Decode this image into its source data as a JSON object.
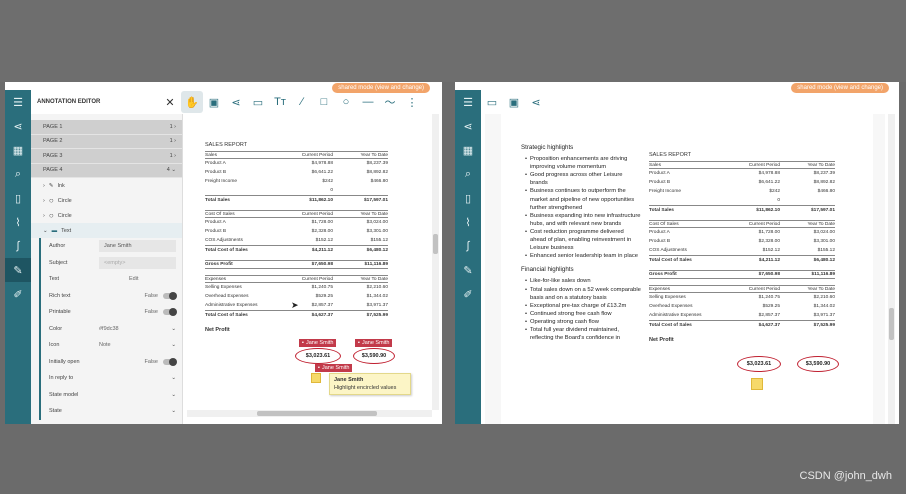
{
  "badge": "shared mode (view and change)",
  "left": {
    "panel_title": "ANNOTATION EDITOR",
    "rail_icons": [
      "menu-icon",
      "share-icon",
      "thumbnails-icon",
      "search-icon",
      "bookmark-icon",
      "attachment-icon",
      "signature-icon",
      "annotation-edit-icon",
      "form-edit-icon"
    ],
    "toolbar_icons": [
      "close-icon",
      "hand-icon",
      "save-icon",
      "share-icon",
      "comment-icon",
      "text-icon",
      "square-icon",
      "rectangle-icon",
      "circle-icon",
      "line-icon",
      "polyline-icon",
      "more-icon"
    ],
    "pages": [
      {
        "label": "PAGE 1",
        "count": "1"
      },
      {
        "label": "PAGE 2",
        "count": "1"
      },
      {
        "label": "PAGE 3",
        "count": "1"
      },
      {
        "label": "PAGE 4",
        "count": "4"
      }
    ],
    "tree": [
      "Ink",
      "Circle",
      "Circle",
      "Text"
    ],
    "props": {
      "author_k": "Author",
      "author_v": "Jane Smith",
      "subject_k": "Subject",
      "subject_v": "<empty>",
      "text_k": "Text",
      "text_v": "Edit",
      "rich_k": "Rich text",
      "rich_v": "False",
      "printable_k": "Printable",
      "printable_v": "False",
      "color_k": "Color",
      "color_v": "#f9dc38",
      "icon_k": "Icon",
      "icon_v": "Note",
      "open_k": "Initially open",
      "open_v": "False",
      "reply_k": "In reply to",
      "state_model_k": "State model",
      "state_k": "State"
    }
  },
  "report": {
    "title": "SALES REPORT",
    "col2": "Current Period",
    "col3": "Year To Date",
    "sales_hdr": "Sales",
    "sales": [
      {
        "name": "Product A",
        "cur": "$4,978.88",
        "ytd": "$8,237.39"
      },
      {
        "name": "Product B",
        "cur": "$6,641.22",
        "ytd": "$8,892.82"
      },
      {
        "name": "Freight Income",
        "cur": "$242",
        "ytd": "$466.80"
      },
      {
        "name": "",
        "cur": "0",
        "ytd": ""
      }
    ],
    "sales_total": {
      "name": "Total Sales",
      "cur": "$11,862.10",
      "ytd": "$17,597.01"
    },
    "cos_hdr": "Cost Of Sales",
    "cos": [
      {
        "name": "Product A",
        "cur": "$1,728.00",
        "ytd": "$3,024.00"
      },
      {
        "name": "Product B",
        "cur": "$2,328.00",
        "ytd": "$3,301.00"
      },
      {
        "name": "COS Adjustments",
        "cur": "$152.12",
        "ytd": "$155.12"
      }
    ],
    "cos_total": {
      "name": "Total Cost of Sales",
      "cur": "$4,211.12",
      "ytd": "$6,480.12"
    },
    "gross": {
      "name": "Gross Profit",
      "cur": "$7,650.98",
      "ytd": "$11,116.89"
    },
    "exp_hdr": "Expenses",
    "exp": [
      {
        "name": "Selling Expenses",
        "cur": "$1,240.75",
        "ytd": "$2,210.60"
      },
      {
        "name": "Overhead Expenses",
        "cur": "$529.25",
        "ytd": "$1,344.02"
      },
      {
        "name": "Administrative Expenses",
        "cur": "$2,857.37",
        "ytd": "$3,971.37"
      }
    ],
    "exp_total": {
      "name": "Total Cost of Sales",
      "cur": "$4,627.37",
      "ytd": "$7,525.99"
    },
    "net_label": "Net Profit",
    "net_cur": "$3,023.61",
    "net_ytd": "$3,590.90"
  },
  "annot": {
    "author": "Jane Smith",
    "tooltip_note": "Highlight encircled values"
  },
  "right": {
    "toolbar_icons": [
      "menu-icon",
      "open-icon",
      "save-icon",
      "share-icon"
    ],
    "rail_icons": [
      "share-icon",
      "thumbnails-icon",
      "search-icon",
      "bookmark-icon",
      "attachment-icon",
      "signature-icon",
      "annotation-edit-icon",
      "form-edit-icon"
    ],
    "strategic_title": "Strategic highlights",
    "strategic": [
      "Proposition enhancements are driving improving volume momentum",
      "Good progress across other Leisure brands",
      "Business continues to outperform the market and pipeline of new opportunities further strengthened",
      "Business expanding into new infrastructure hubs, and with relevant new brands",
      "Cost reduction programme delivered ahead of plan, enabling reinvestment in Leisure business",
      "Enhanced senior leadership team in place"
    ],
    "financial_title": "Financial highlights",
    "financial": [
      "Like-for-like sales down",
      "Total sales down on a 52 week comparable basis and on a statutory basis",
      "Exceptional pre-tax charge of £13.2m",
      "Continued strong free cash flow",
      "Operating strong cash flow",
      "Total full year dividend maintained, reflecting the Board's confidence in"
    ]
  },
  "watermark": "CSDN @john_dwh"
}
